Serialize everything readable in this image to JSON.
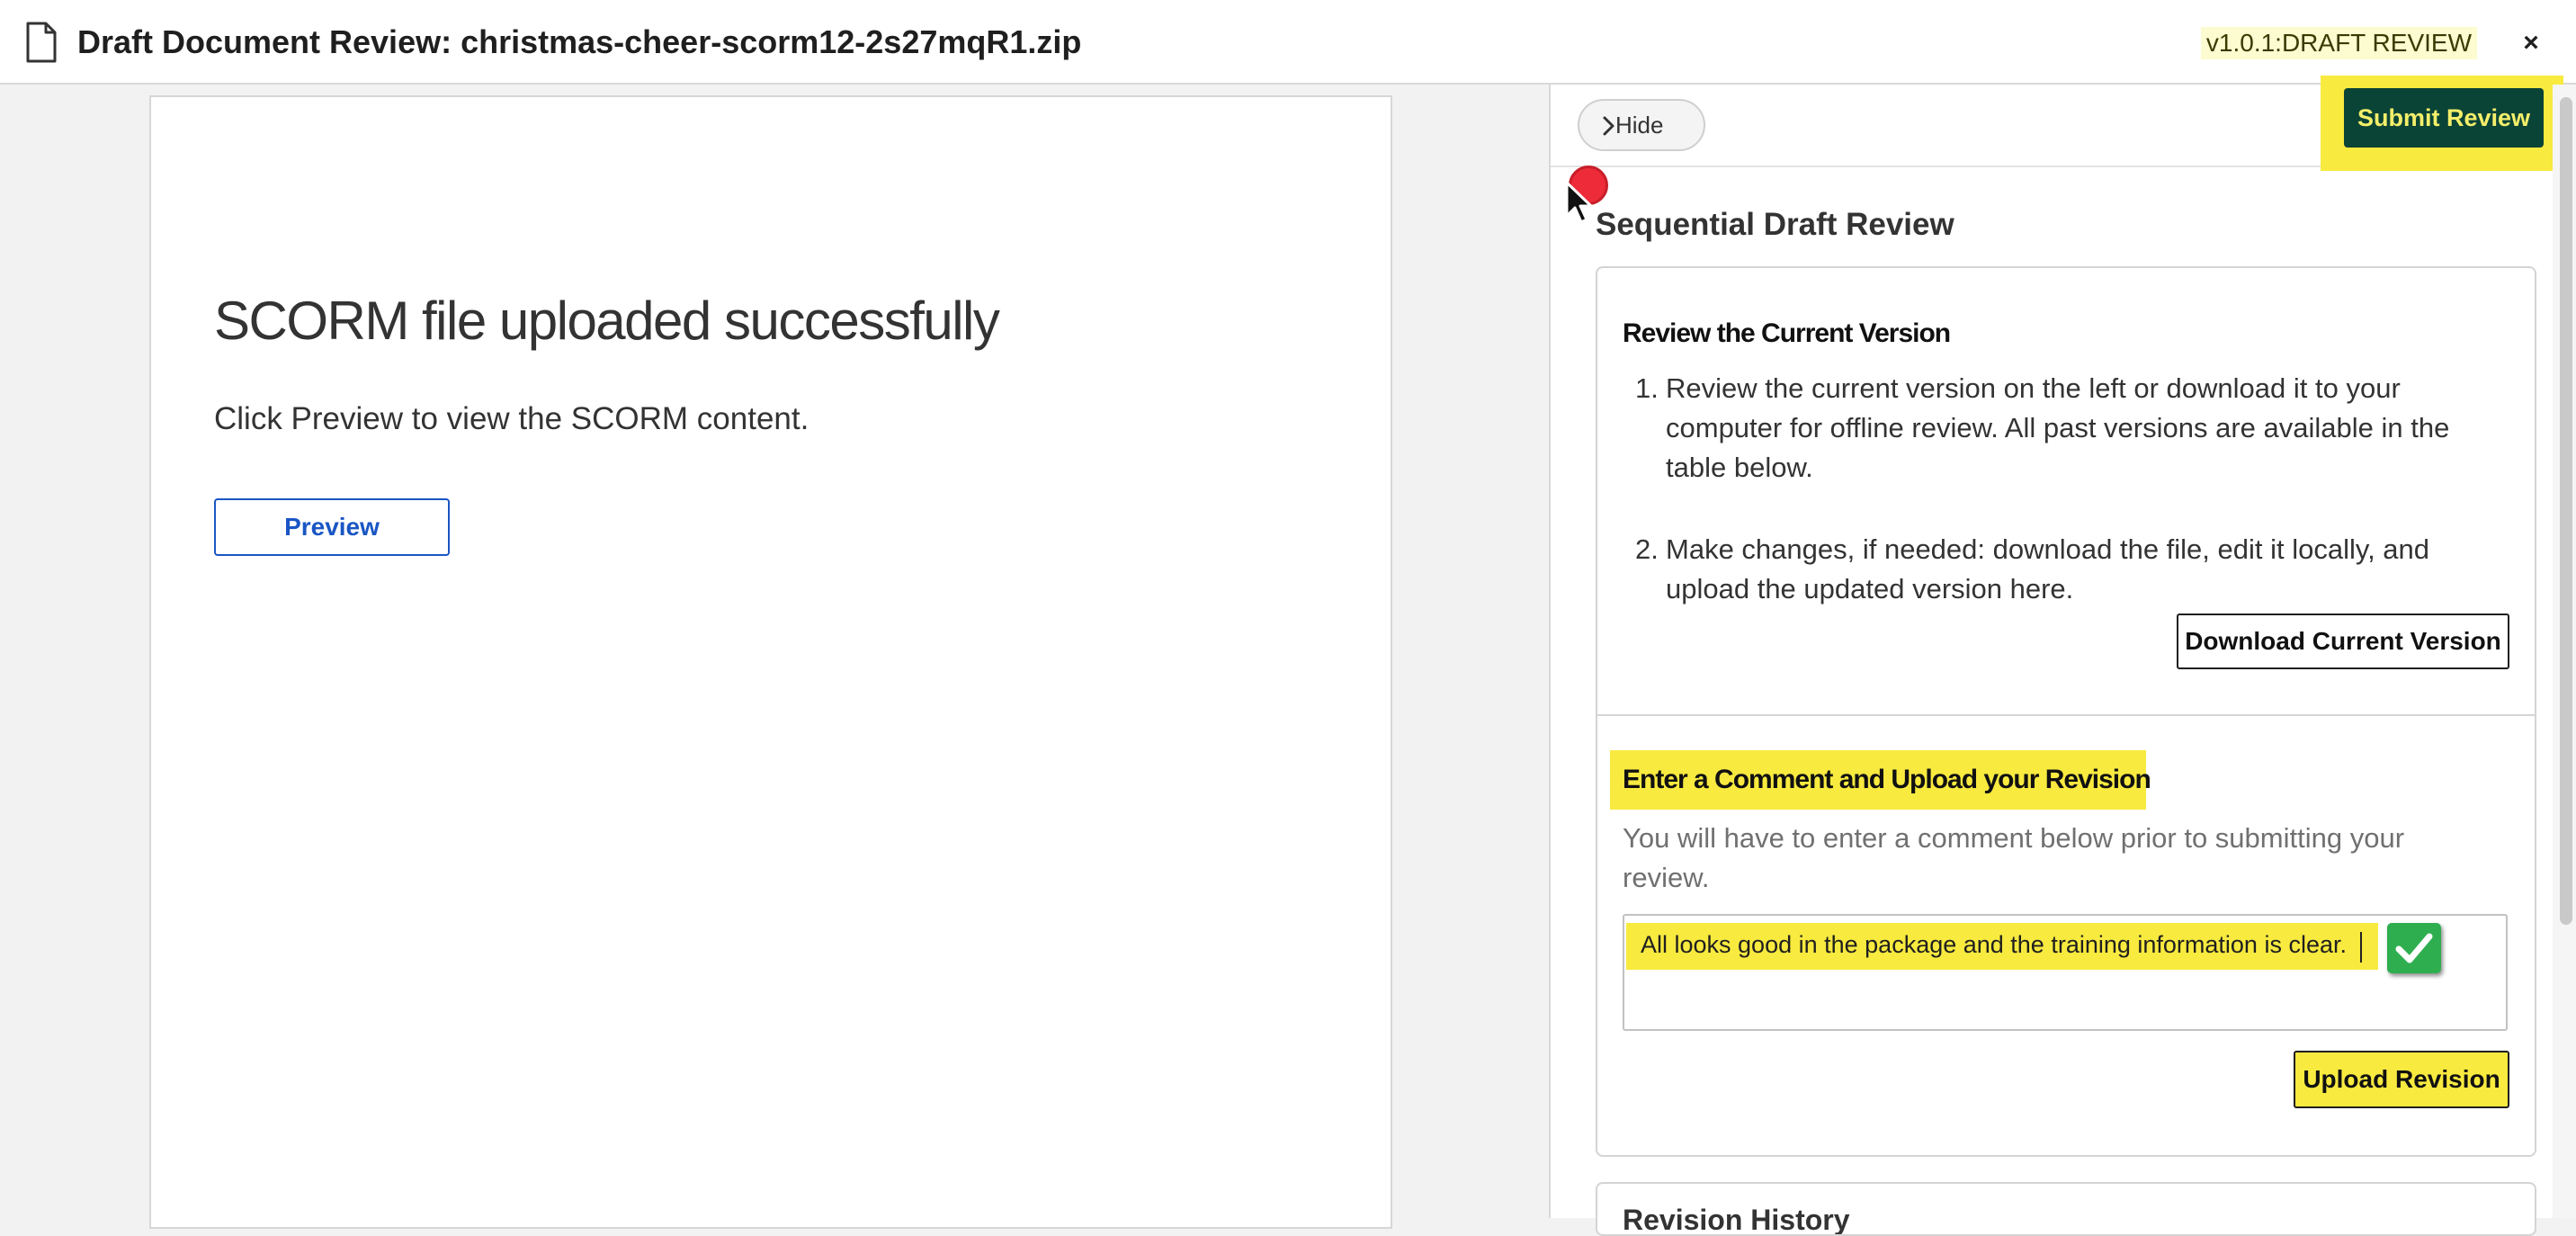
{
  "header": {
    "title": "Draft Document Review: christmas-cheer-scorm12-2s27mqR1.zip",
    "version": "v1.0.1:DRAFT REVIEW",
    "close_label": "×"
  },
  "document": {
    "heading": "SCORM file uploaded successfully",
    "subtext": "Click Preview to view the SCORM content.",
    "preview_label": "Preview"
  },
  "panel": {
    "hide_label": "Hide",
    "submit_label": "Submit Review",
    "title": "Sequential Draft Review",
    "section1": {
      "title": "Review the Current Version",
      "steps": [
        {
          "num": "1.",
          "text": "Review the current version on the left or download it to your computer for offline review. All past versions are available in the table below."
        },
        {
          "num": "2.",
          "text": "Make changes, if needed: download the file, edit it locally, and upload the updated version here."
        }
      ],
      "download_label": "Download Current Version"
    },
    "section2": {
      "title": "Enter a Comment and Upload your Revision",
      "note": "You will have to enter a comment below prior to submitting your review.",
      "comment_value": "All looks good in the package and the training information is clear.",
      "upload_label": "Upload Revision"
    },
    "section3": {
      "title": "Revision History"
    }
  },
  "colors": {
    "highlight": "#f8ea3f",
    "submit_bg": "#0a4436",
    "link_blue": "#1a56c4",
    "check_green": "#2fae4f",
    "cursor_red": "#ee2b38"
  },
  "icons": [
    "document-icon",
    "close-icon",
    "chevron-right-icon",
    "checkmark-icon",
    "mouse-pointer-icon"
  ]
}
